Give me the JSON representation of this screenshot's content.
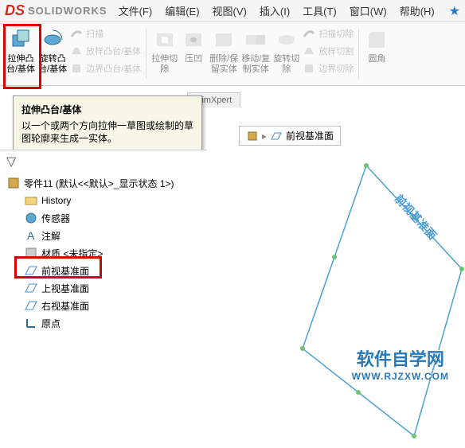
{
  "app": {
    "logo_ds": "DS",
    "logo_text": "SOLIDWORKS"
  },
  "menu": [
    "文件(F)",
    "编辑(E)",
    "视图(V)",
    "插入(I)",
    "工具(T)",
    "窗口(W)",
    "帮助(H)"
  ],
  "ribbon": {
    "extrude": "拉伸凸\n台/基体",
    "revolve": "旋转凸\n台/基体",
    "sweep": "扫描",
    "loft": "放样凸台/基体",
    "boundary": "边界凸台/基体",
    "cut_extrude": "拉伸切\n除",
    "hole": "压凹",
    "delete_keep": "删除/保\n留实体",
    "move_copy": "移动/复\n制实体",
    "cut_revolve": "旋转切\n除",
    "sweep_cut": "扫描切除",
    "loft_cut": "放样切割",
    "boundary_cut": "边界切除",
    "fillet": "圆角"
  },
  "tabs": [
    "SimXpert"
  ],
  "tooltip": {
    "title": "拉伸凸台/基体",
    "body": "以一个或两个方向拉伸一草图或绘制的草图轮廓来生成一实体。"
  },
  "breadcrumb": {
    "label": "前视基准面"
  },
  "tree": {
    "root": "零件11 (默认<<默认>_显示状态 1>)",
    "history": "History",
    "sensors": "传感器",
    "notes": "注解",
    "material": "材质 <未指定>",
    "front_plane": "前视基准面",
    "top_plane": "上视基准面",
    "right_plane": "右视基准面",
    "origin": "原点"
  },
  "viewport_label": "前视基准面",
  "watermark": {
    "main": "软件自学网",
    "sub": "WWW.RJZXW.COM"
  }
}
